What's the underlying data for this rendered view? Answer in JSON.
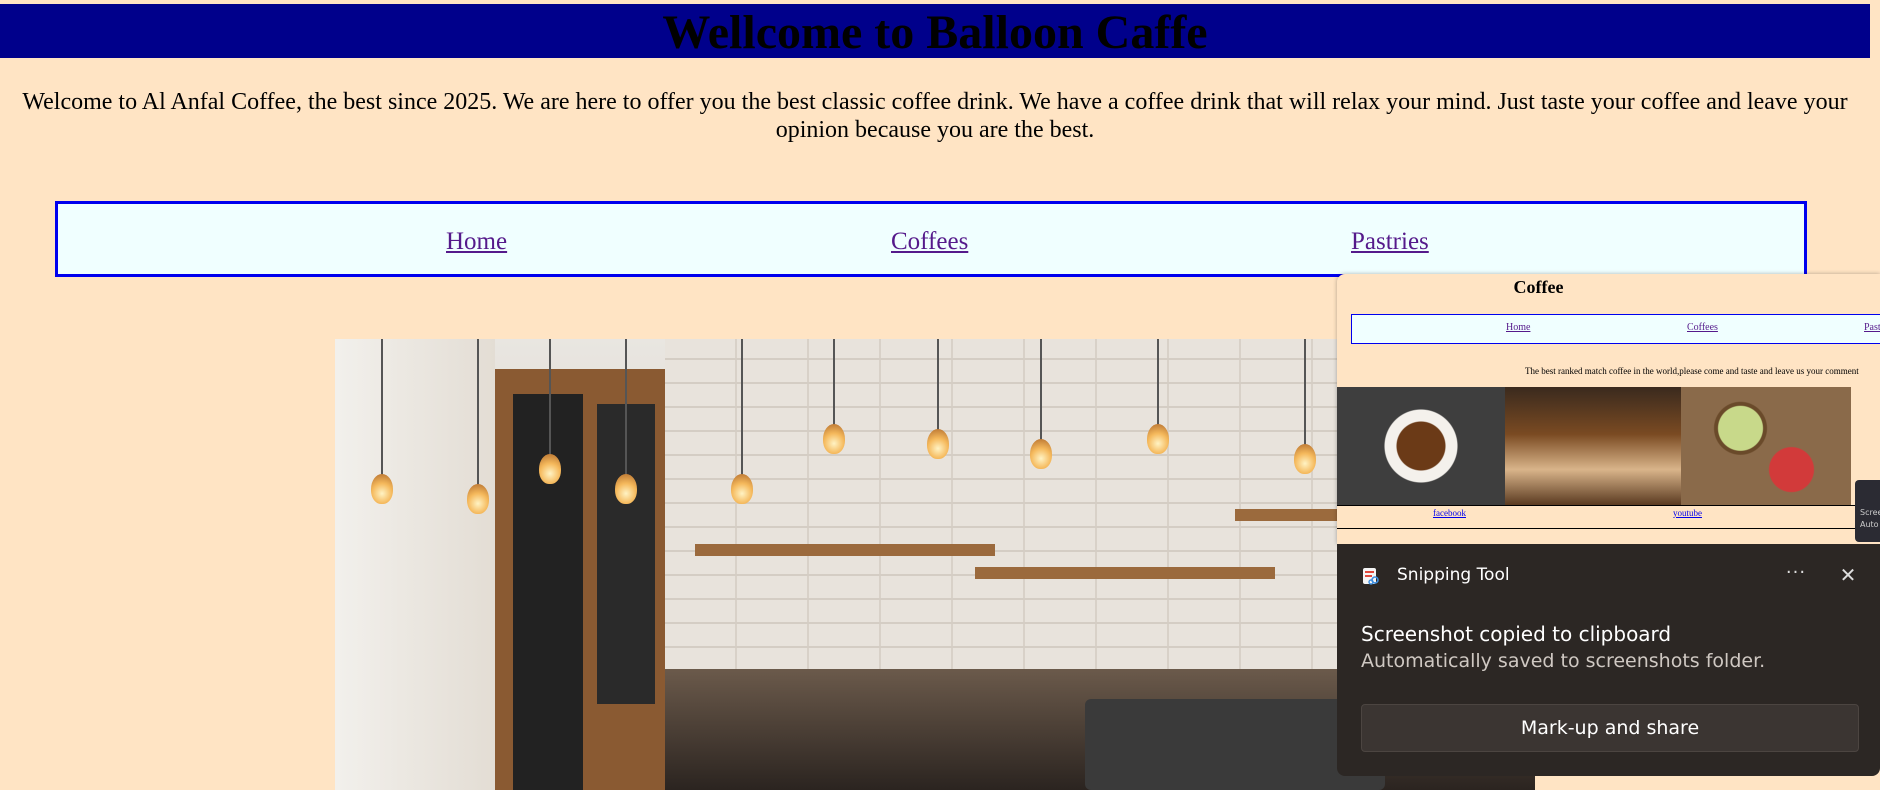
{
  "header": {
    "title": "Wellcome to Balloon Caffe"
  },
  "intro": {
    "text": "Welcome to Al Anfal Coffee, the best since 2025. We are here to offer you the best classic coffee drink. We have a coffee drink that will relax your mind. Just taste your coffee and leave your opinion because you are the best."
  },
  "nav": {
    "items": [
      {
        "label": "Home"
      },
      {
        "label": "Coffees"
      },
      {
        "label": "Pastries"
      }
    ]
  },
  "preview": {
    "title": "Coffee",
    "nav": [
      "Home",
      "Coffees",
      "Past"
    ],
    "text": "The best ranked match coffee in the world,please come and taste and leave us your comment",
    "footer": [
      "facebook",
      "youtube"
    ]
  },
  "side_notification": {
    "line1": "Scree",
    "line2": "Auto"
  },
  "toast": {
    "app_name": "Snipping Tool",
    "more_label": "···",
    "close_label": "✕",
    "message": "Screenshot copied to clipboard",
    "detail": "Automatically saved to screenshots folder.",
    "action_label": "Mark-up and share"
  },
  "colors": {
    "page_bg": "#ffe4c4",
    "banner_bg": "#00008b",
    "nav_border": "#0000ee",
    "nav_bg": "#f0ffff",
    "link_visited": "#551a8b",
    "toast_bg": "#2c2724"
  }
}
